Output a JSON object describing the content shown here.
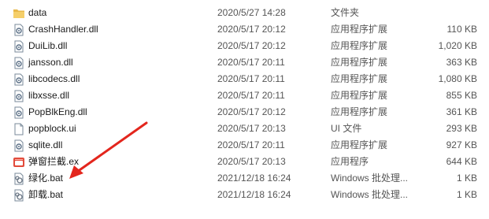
{
  "files": [
    {
      "name": "data",
      "date": "2020/5/27 14:28",
      "type": "文件夹",
      "size": "",
      "icon": "folder-icon"
    },
    {
      "name": "CrashHandler.dll",
      "date": "2020/5/17 20:12",
      "type": "应用程序扩展",
      "size": "110 KB",
      "icon": "dll-file-icon"
    },
    {
      "name": "DuiLib.dll",
      "date": "2020/5/17 20:12",
      "type": "应用程序扩展",
      "size": "1,020 KB",
      "icon": "dll-file-icon"
    },
    {
      "name": "jansson.dll",
      "date": "2020/5/17 20:11",
      "type": "应用程序扩展",
      "size": "363 KB",
      "icon": "dll-file-icon"
    },
    {
      "name": "libcodecs.dll",
      "date": "2020/5/17 20:11",
      "type": "应用程序扩展",
      "size": "1,080 KB",
      "icon": "dll-file-icon"
    },
    {
      "name": "libxsse.dll",
      "date": "2020/5/17 20:11",
      "type": "应用程序扩展",
      "size": "855 KB",
      "icon": "dll-file-icon"
    },
    {
      "name": "PopBlkEng.dll",
      "date": "2020/5/17 20:12",
      "type": "应用程序扩展",
      "size": "361 KB",
      "icon": "dll-file-icon"
    },
    {
      "name": "popblock.ui",
      "date": "2020/5/17 20:13",
      "type": "UI 文件",
      "size": "293 KB",
      "icon": "blank-file-icon"
    },
    {
      "name": "sqlite.dll",
      "date": "2020/5/17 20:11",
      "type": "应用程序扩展",
      "size": "927 KB",
      "icon": "dll-file-icon"
    },
    {
      "name": "弹窗拦截.ex",
      "date": "2020/5/17 20:13",
      "type": "应用程序",
      "size": "644 KB",
      "icon": "exe-app-icon"
    },
    {
      "name": "绿化.bat",
      "date": "2021/12/18 16:24",
      "type": "Windows 批处理...",
      "size": "1 KB",
      "icon": "bat-file-icon"
    },
    {
      "name": "卸载.bat",
      "date": "2021/12/18 16:24",
      "type": "Windows 批处理...",
      "size": "1 KB",
      "icon": "bat-file-icon"
    }
  ],
  "colors": {
    "folder": "#e8b84a",
    "exe": "#e24b3b",
    "arrow": "#e3261d"
  }
}
